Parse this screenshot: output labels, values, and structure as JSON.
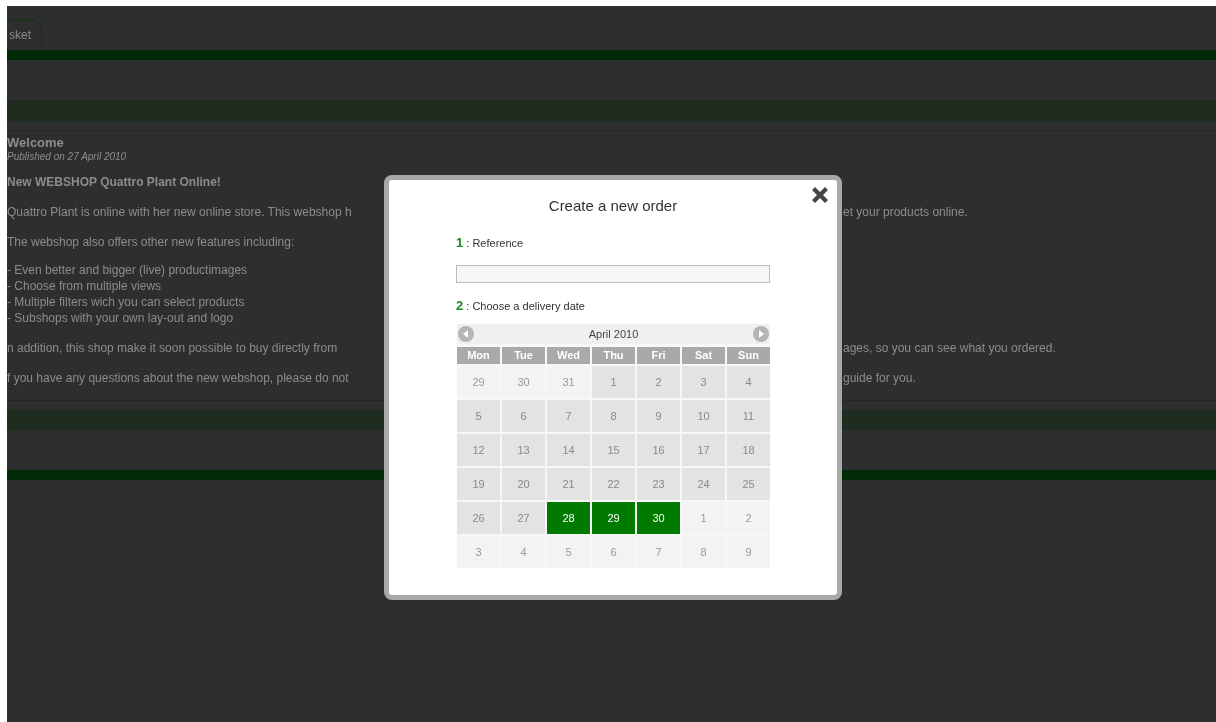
{
  "page": {
    "tab": "sket",
    "article": {
      "title": "Welcome",
      "published": "Published on 27 April 2010",
      "heading": "New WEBSHOP Quattro Plant Online!",
      "paragraphs": [
        {
          "left": "Quattro Plant is online with her new online store. This webshop h",
          "right": "et your products online."
        },
        {
          "left": "The webshop also offers other new features including:"
        },
        {
          "kind": "list",
          "items": [
            "- Even better and bigger (live) productimages",
            "- Choose from multiple views",
            "- Multiple filters wich you can select products",
            "- Subshops with your own lay-out and logo"
          ]
        },
        {
          "left": "n addition, this shop make it soon possible to buy directly from",
          "right": "ages, so you can see what you ordered."
        },
        {
          "left": "f you have any questions about the new webshop, please do not",
          "right": "guide for you."
        }
      ]
    }
  },
  "dialog": {
    "title": "Create a new order",
    "steps": [
      {
        "number": "1",
        "label": " : Reference"
      },
      {
        "number": "2",
        "label": " : Choose a delivery date"
      }
    ],
    "calendar": {
      "month": "April 2010",
      "weekdays": [
        "Mon",
        "Tue",
        "Wed",
        "Thu",
        "Fri",
        "Sat",
        "Sun"
      ],
      "days": [
        {
          "day": "29",
          "kind": "outside"
        },
        {
          "day": "30",
          "kind": "outside"
        },
        {
          "day": "31",
          "kind": "outside"
        },
        {
          "day": "1",
          "kind": "disabled"
        },
        {
          "day": "2",
          "kind": "disabled"
        },
        {
          "day": "3",
          "kind": "disabled"
        },
        {
          "day": "4",
          "kind": "disabled"
        },
        {
          "day": "5",
          "kind": "disabled"
        },
        {
          "day": "6",
          "kind": "disabled"
        },
        {
          "day": "7",
          "kind": "disabled"
        },
        {
          "day": "8",
          "kind": "disabled"
        },
        {
          "day": "9",
          "kind": "disabled"
        },
        {
          "day": "10",
          "kind": "disabled"
        },
        {
          "day": "11",
          "kind": "disabled"
        },
        {
          "day": "12",
          "kind": "disabled"
        },
        {
          "day": "13",
          "kind": "disabled"
        },
        {
          "day": "14",
          "kind": "disabled"
        },
        {
          "day": "15",
          "kind": "disabled"
        },
        {
          "day": "16",
          "kind": "disabled"
        },
        {
          "day": "17",
          "kind": "disabled"
        },
        {
          "day": "18",
          "kind": "disabled"
        },
        {
          "day": "19",
          "kind": "disabled"
        },
        {
          "day": "20",
          "kind": "disabled"
        },
        {
          "day": "21",
          "kind": "disabled"
        },
        {
          "day": "22",
          "kind": "disabled"
        },
        {
          "day": "23",
          "kind": "disabled"
        },
        {
          "day": "24",
          "kind": "disabled"
        },
        {
          "day": "25",
          "kind": "disabled"
        },
        {
          "day": "26",
          "kind": "disabled"
        },
        {
          "day": "27",
          "kind": "disabled"
        },
        {
          "day": "28",
          "kind": "available"
        },
        {
          "day": "29",
          "kind": "available"
        },
        {
          "day": "30",
          "kind": "available"
        },
        {
          "day": "1",
          "kind": "outside"
        },
        {
          "day": "2",
          "kind": "outside"
        },
        {
          "day": "3",
          "kind": "outside"
        },
        {
          "day": "4",
          "kind": "outside"
        },
        {
          "day": "5",
          "kind": "outside"
        },
        {
          "day": "6",
          "kind": "outside"
        },
        {
          "day": "7",
          "kind": "outside"
        },
        {
          "day": "8",
          "kind": "outside"
        },
        {
          "day": "9",
          "kind": "outside"
        }
      ]
    }
  }
}
